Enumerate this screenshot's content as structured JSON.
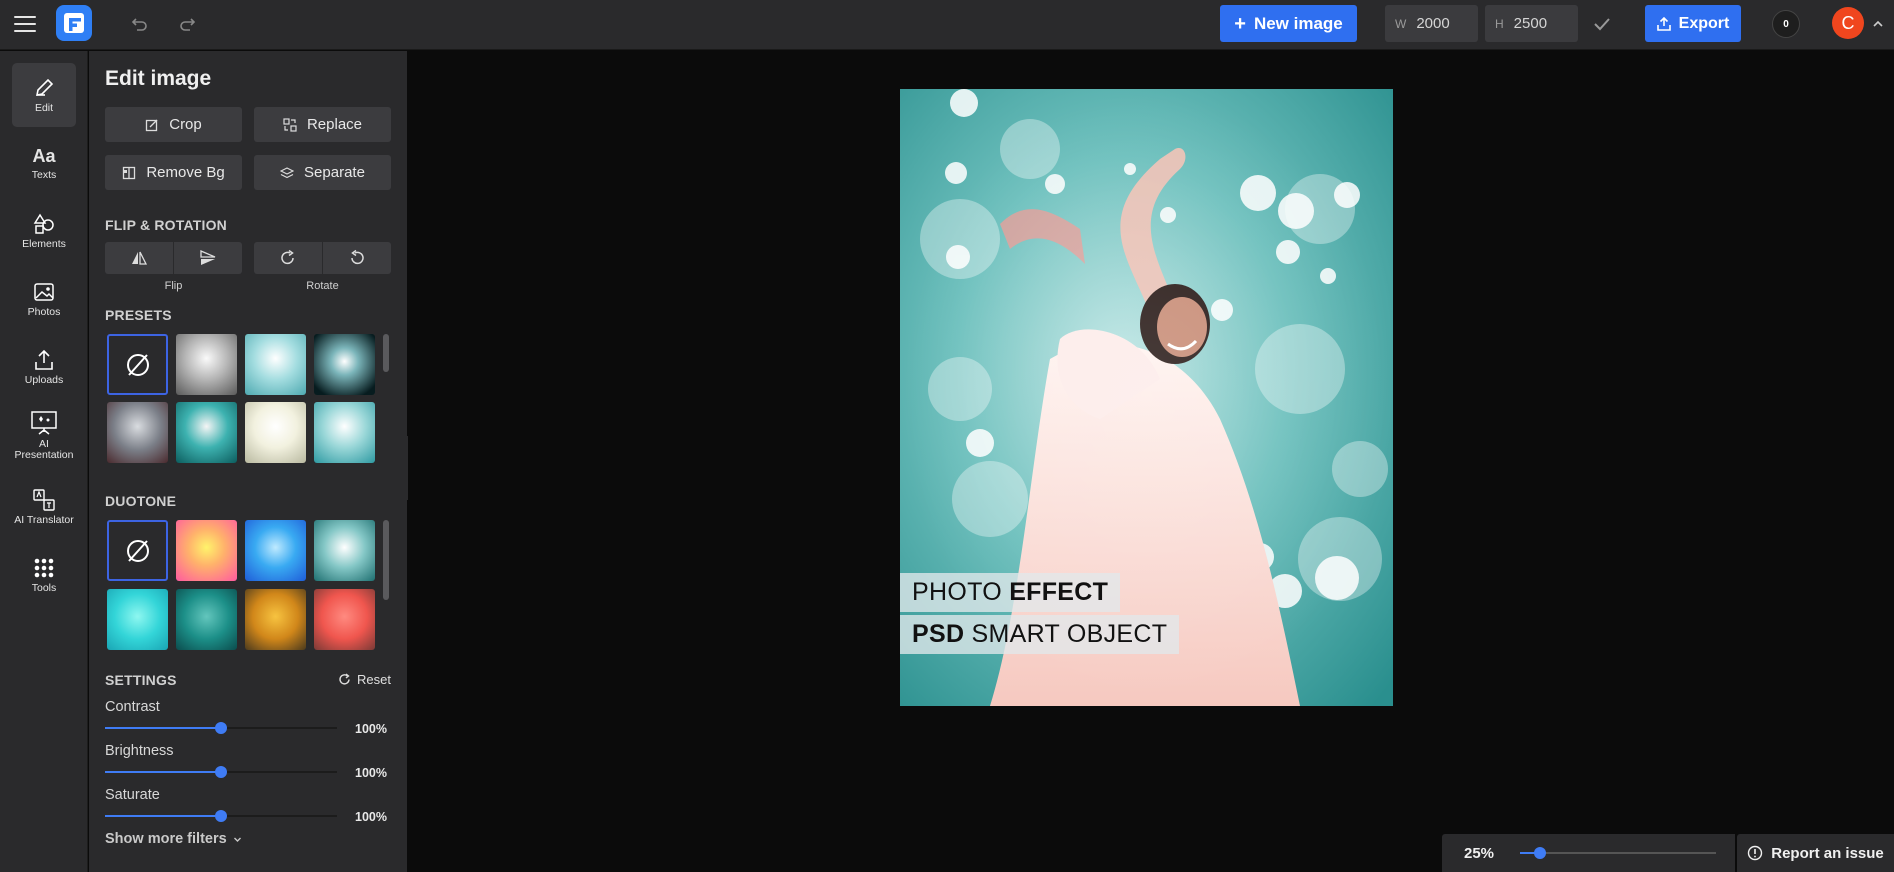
{
  "topbar": {
    "new_image_label": "New image",
    "width_label": "W",
    "width_value": "2000",
    "height_label": "H",
    "height_value": "2500",
    "export_label": "Export",
    "notification_count": "0",
    "avatar_initial": "C"
  },
  "sidebar": {
    "items": [
      {
        "label": "Edit",
        "icon": "pencil-icon",
        "active": true
      },
      {
        "label": "Texts",
        "icon": "text-icon"
      },
      {
        "label": "Elements",
        "icon": "shapes-icon"
      },
      {
        "label": "Photos",
        "icon": "image-icon"
      },
      {
        "label": "Uploads",
        "icon": "upload-icon"
      },
      {
        "label": "AI Presentation",
        "icon": "presentation-icon"
      },
      {
        "label": "AI Translator",
        "icon": "translate-icon"
      },
      {
        "label": "Tools",
        "icon": "grid-icon"
      }
    ]
  },
  "panel": {
    "title": "Edit image",
    "buttons": {
      "crop": "Crop",
      "replace": "Replace",
      "remove_bg": "Remove Bg",
      "separate": "Separate"
    },
    "flip_rotation_title": "FLIP & ROTATION",
    "flip_label": "Flip",
    "rotate_label": "Rotate",
    "presets_title": "PRESETS",
    "duotone_title": "DUOTONE",
    "settings_title": "SETTINGS",
    "reset_label": "Reset",
    "settings": [
      {
        "label": "Contrast",
        "value": "100%",
        "level": 0.5
      },
      {
        "label": "Brightness",
        "value": "100%",
        "level": 0.5
      },
      {
        "label": "Saturate",
        "value": "100%",
        "level": 0.5
      }
    ],
    "show_more_label": "Show more filters"
  },
  "canvas": {
    "line1_normal": "PHOTO ",
    "line1_bold": "EFFECT",
    "line2_bold": "PSD",
    "line2_normal": " SMART OBJECT"
  },
  "footer": {
    "zoom_value": "25%",
    "zoom_level": 0.1,
    "report_label": "Report an issue"
  },
  "colors": {
    "accent": "#2f6ff0",
    "avatar": "#f0461e",
    "panel_bg": "#2a2a2c",
    "canvas_bg": "#0b0b0b"
  }
}
